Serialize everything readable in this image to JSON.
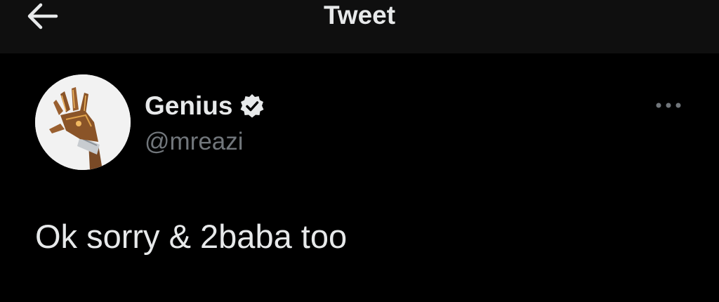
{
  "header": {
    "title": "Tweet",
    "back_icon": "arrow-left-icon"
  },
  "tweet": {
    "author": {
      "name": "Genius",
      "handle": "@mreazi",
      "verified": true,
      "verified_icon": "verified-badge-icon"
    },
    "more_icon": "more-horizontal-icon",
    "text": "Ok sorry & 2baba too"
  },
  "colors": {
    "background": "#000000",
    "header_background": "#0f0f0f",
    "primary_text": "#e7e9ea",
    "secondary_text": "#71767b"
  }
}
